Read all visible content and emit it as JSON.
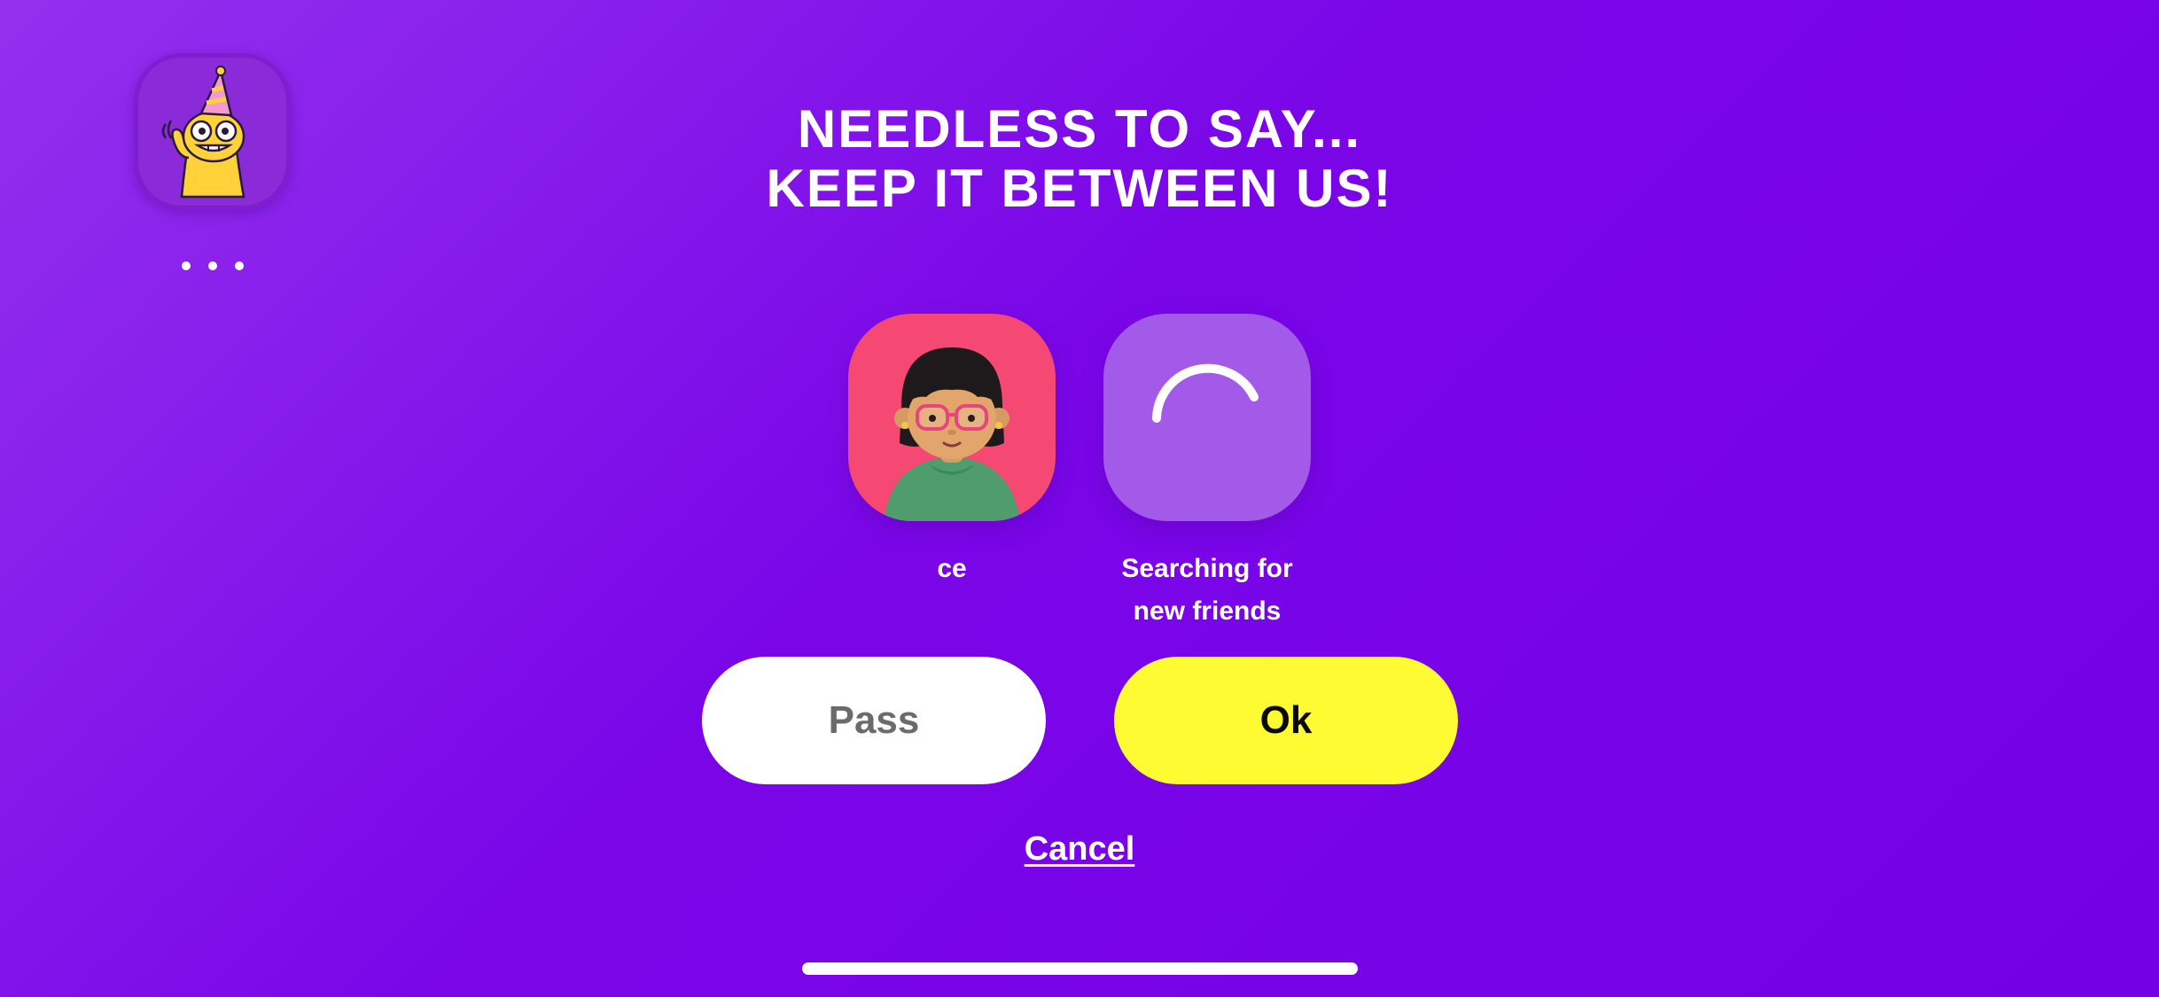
{
  "header": {
    "title_line1": "NEEDLESS TO SAY...",
    "title_line2": "KEEP IT BETWEEN US!",
    "app_icon": "party-hat-creature-icon",
    "menu_icon": "more-dots-icon"
  },
  "participants": [
    {
      "label": "ce",
      "avatar": "girl-with-glasses-avatar"
    },
    {
      "label_line1": "Searching for",
      "label_line2": "new friends",
      "avatar": "loading-spinner-icon"
    }
  ],
  "actions": {
    "pass_label": "Pass",
    "ok_label": "Ok",
    "cancel_label": "Cancel"
  },
  "colors": {
    "background_start": "#9331ee",
    "background_end": "#7400e6",
    "person_card": "#f54873",
    "searching_card": "#a45ae9",
    "ok_button": "#fffb33",
    "pass_button": "#ffffff",
    "pass_text": "#6b6b6b"
  }
}
